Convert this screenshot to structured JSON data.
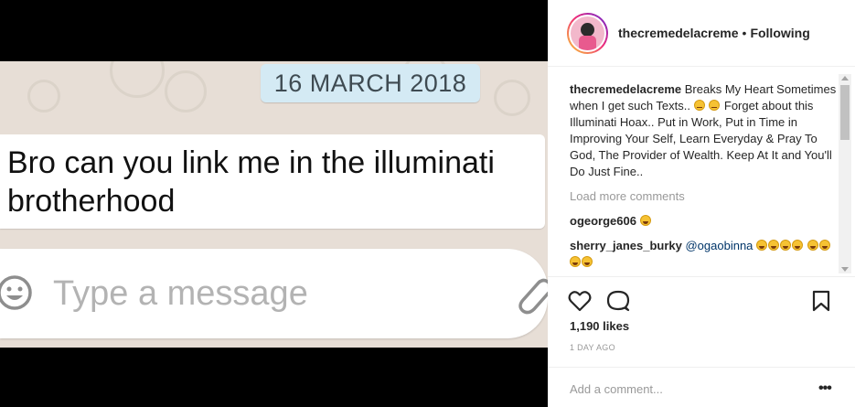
{
  "media": {
    "date_chip": "16 MARCH 2018",
    "message": "Bro can you link me in the illuminati brotherhood",
    "composer_placeholder": "Type a message"
  },
  "header": {
    "username": "thecremedelacreme",
    "separator": "•",
    "follow_status": "Following"
  },
  "caption": {
    "username": "thecremedelacreme",
    "text_before_emoji": "Breaks My Heart Sometimes when I get such Texts..",
    "text_after_emoji": "Forget about this Illuminati Hoax.. Put in Work, Put in Time in Improving Your Self, Learn Everyday & Pray To God, The Provider of Wealth. Keep At It and You'll Do Just Fine.."
  },
  "load_more_label": "Load more comments",
  "comments": [
    {
      "username": "ogeorge606",
      "mention": ""
    },
    {
      "username": "sherry_janes_burky",
      "mention": "@ogaobinna"
    }
  ],
  "icons": {
    "like": "heart-icon",
    "comment": "comment-bubble-icon",
    "save": "bookmark-icon",
    "more": "more-options-icon",
    "emoji": "smiley-icon",
    "attach": "paperclip-icon"
  },
  "likes": "1,190 likes",
  "post_time": "1 DAY AGO",
  "add_comment_placeholder": "Add a comment...",
  "more_label": "•••",
  "colors": {
    "chat_background": "#e7ded6",
    "date_chip": "#d4eaf4",
    "mention": "#003569",
    "muted_text": "#999999"
  }
}
